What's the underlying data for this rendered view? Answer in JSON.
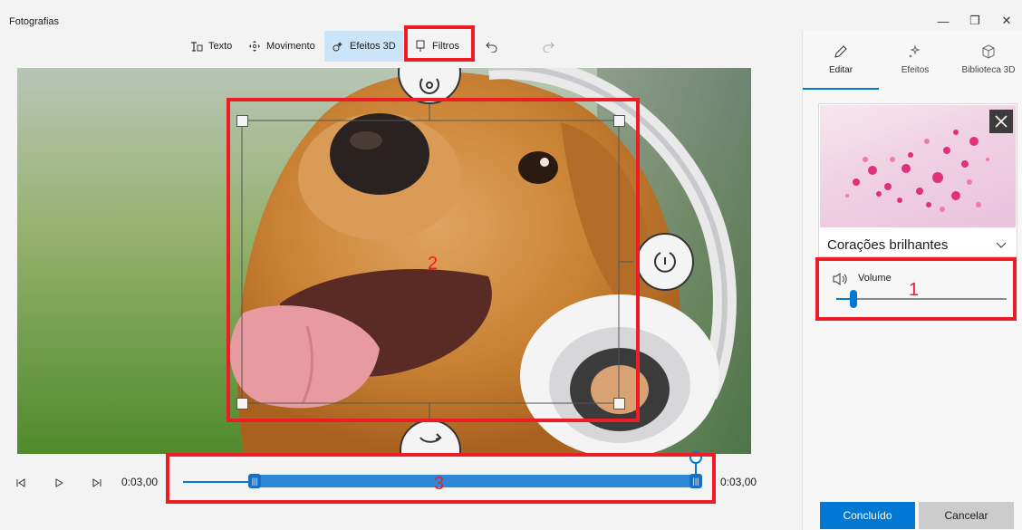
{
  "window": {
    "title": "Fotografias",
    "controls": [
      "—",
      "❐",
      "✕"
    ]
  },
  "toolbar": {
    "text_label": "Texto",
    "move_label": "Movimento",
    "effects3d_label": "Efeitos 3D",
    "filters_label": "Filtros"
  },
  "playback": {
    "current_time": "0:03,00",
    "end_time": "0:03,00",
    "trim_start_fraction": 0.14,
    "trim_end_fraction": 1.0
  },
  "panel": {
    "tabs": [
      {
        "label": "Editar",
        "icon": "pencil-icon",
        "active": true
      },
      {
        "label": "Efeitos",
        "icon": "sparkle-icon",
        "active": false
      },
      {
        "label": "Biblioteca 3D",
        "icon": "cube-icon",
        "active": false
      }
    ],
    "effect": {
      "name": "Corações brilhantes"
    },
    "volume": {
      "label": "Volume",
      "level": 0.1
    },
    "done_label": "Concluído",
    "cancel_label": "Cancelar"
  },
  "annotations": {
    "box1": "1",
    "box2": "2",
    "box3": "3"
  },
  "colors": {
    "accent": "#0078d4",
    "annotation": "#ee1c24",
    "active_tool_bg": "#cce4f7"
  }
}
